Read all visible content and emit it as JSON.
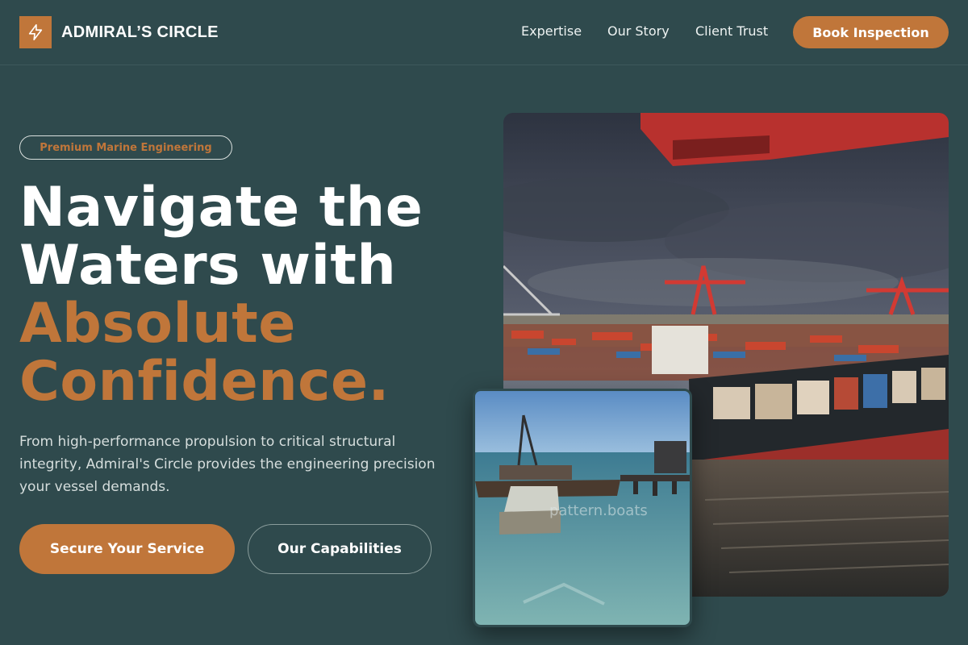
{
  "header": {
    "brand_name": "ADMIRAL’S CIRCLE",
    "brand_icon": "lightning-bolt-icon",
    "nav": [
      {
        "label": "Expertise"
      },
      {
        "label": "Our Story"
      },
      {
        "label": "Client Trust"
      }
    ],
    "cta_label": "Book Inspection"
  },
  "hero": {
    "badge": "Premium Marine Engineering",
    "headline_line1": "Navigate the",
    "headline_line2": "Waters with",
    "headline_accent_line1": "Absolute",
    "headline_accent_line2": "Confidence.",
    "lead": "From high-performance propulsion to critical structural integrity, Admiral's Circle provides the engineering precision your vessel demands.",
    "primary_cta": "Secure Your Service",
    "secondary_cta": "Our Capabilities"
  },
  "images": {
    "inset_watermark": "pattern.boats"
  },
  "colors": {
    "background": "#2f4a4d",
    "accent": "#c0763a",
    "text": "#ffffff"
  }
}
